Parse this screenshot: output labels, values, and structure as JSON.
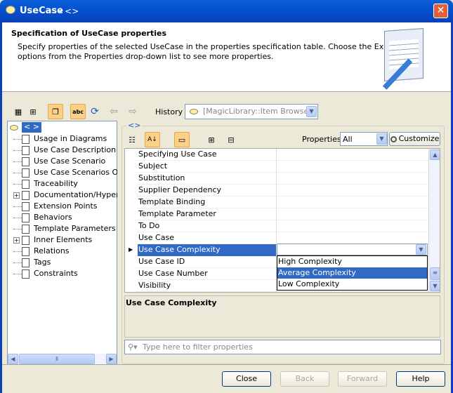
{
  "window": {
    "title": "UseCase",
    "title_suffix": "- <>",
    "close_icon": "close-icon"
  },
  "header": {
    "title": "Specification of UseCase properties",
    "description_line1": "Specify properties of the selected UseCase in the properties specification table. Choose the Expert or All",
    "description_line2": "options from the Properties drop-down list to see more properties."
  },
  "toolbar": {
    "history_label": "History :",
    "history_value": "[MagicLibrary::Item Browser]"
  },
  "tree": {
    "root_label": "< >",
    "items": [
      "Usage in Diagrams",
      "Use Case Description",
      "Use Case Scenario",
      "Use Case Scenarios Obs",
      "Traceability",
      "Documentation/Hyperlin",
      "Extension Points",
      "Behaviors",
      "Template Parameters",
      "Inner Elements",
      "Relations",
      "Tags",
      "Constraints"
    ],
    "expandable": [
      5,
      9
    ]
  },
  "panel": {
    "legend": "<>",
    "properties_label": "Properties:",
    "properties_value": "All",
    "customize_label": "Customize"
  },
  "table": {
    "rows": [
      "Specifying Use Case",
      "Subject",
      "Substitution",
      "Supplier Dependency",
      "Template Binding",
      "Template Parameter",
      "To Do",
      "Use Case",
      "Use Case Complexity",
      "Use Case ID",
      "Use Case Number",
      "Visibility"
    ],
    "selected_index": 8,
    "dropdown_options": [
      "High Complexity",
      "Average Complexity",
      "Low Complexity"
    ],
    "dropdown_highlight": 1
  },
  "description": {
    "title": "Use Case Complexity"
  },
  "filter": {
    "placeholder": "Type here to filter properties"
  },
  "buttons": {
    "close": "Close",
    "back": "Back",
    "forward": "Forward",
    "help": "Help"
  },
  "colors": {
    "selection": "#316ac5",
    "titlebar": "#0453d0"
  }
}
